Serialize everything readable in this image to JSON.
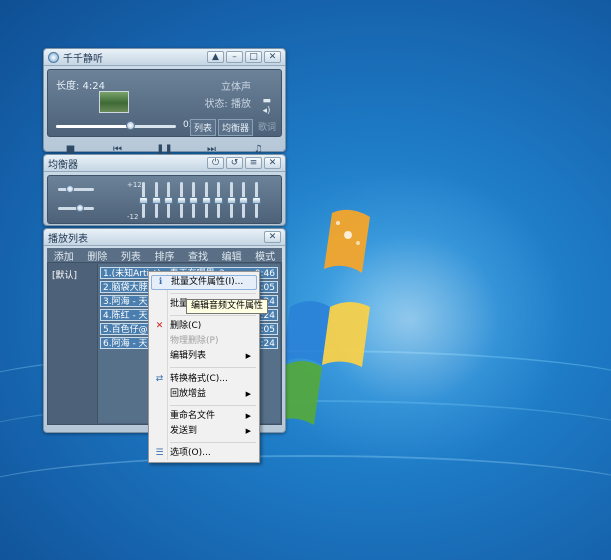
{
  "main": {
    "title": "千千静听",
    "length_label": "长度: 4:24",
    "channel": "立体声",
    "status": "状态: 播放",
    "time": "03:08",
    "progress_fraction": 0.62,
    "tab_playlist": "列表",
    "tab_eq": "均衡器",
    "tab_lyrics": "歌词"
  },
  "equalizer": {
    "title": "均衡器",
    "label_top": "+12",
    "label_bottom": "-12",
    "bands": [
      0.5,
      0.5,
      0.5,
      0.5,
      0.5,
      0.5,
      0.5,
      0.5,
      0.5,
      0.5
    ]
  },
  "playlist": {
    "title": "播放列表",
    "menu": [
      "添加",
      "删除",
      "列表",
      "排序",
      "查找",
      "编辑",
      "模式"
    ],
    "list_name": "[默认]",
    "tracks": [
      {
        "text": "1.(未知Artist) - 春天在哪里_2",
        "dur": "0:46"
      },
      {
        "text": "2.脑袋大脖子",
        "dur": "3:05"
      },
      {
        "text": "3.阿海 - 天涯",
        "dur": "4:24"
      },
      {
        "text": "4.陈红 - 天涯",
        "dur": "4:24"
      },
      {
        "text": "5.百色仔@3",
        "dur": "3:05"
      },
      {
        "text": "6.阿海 - 天涯",
        "dur": "4:24"
      }
    ]
  },
  "context_menu": {
    "items": {
      "batch_props": "批量文件属性(I)...",
      "batch2": "批量",
      "delete": "删除(C)",
      "physical_delete": "物理删除(P)",
      "edit_list": "编辑列表",
      "convert": "转换格式(C)...",
      "replay_gain": "回放增益",
      "rename": "重命名文件",
      "send_to": "发送到",
      "options": "选项(O)..."
    },
    "tooltip": "编辑音频文件属性"
  }
}
